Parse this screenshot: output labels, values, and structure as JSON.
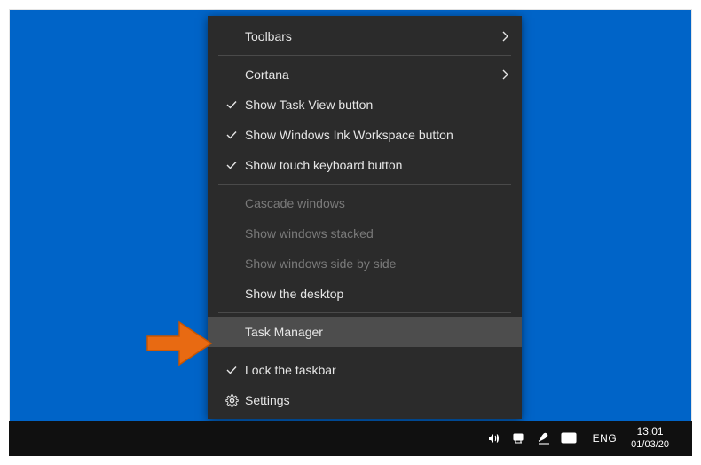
{
  "menu": {
    "toolbars_label": "Toolbars",
    "cortana_label": "Cortana",
    "show_task_view_label": "Show Task View button",
    "show_ink_label": "Show Windows Ink Workspace button",
    "show_touch_kb_label": "Show touch keyboard button",
    "cascade_label": "Cascade windows",
    "stacked_label": "Show windows stacked",
    "side_by_side_label": "Show windows side by side",
    "show_desktop_label": "Show the desktop",
    "task_manager_label": "Task Manager",
    "lock_taskbar_label": "Lock the taskbar",
    "settings_label": "Settings"
  },
  "taskbar": {
    "language": "ENG",
    "time": "13:01",
    "date": "01/03/20"
  }
}
